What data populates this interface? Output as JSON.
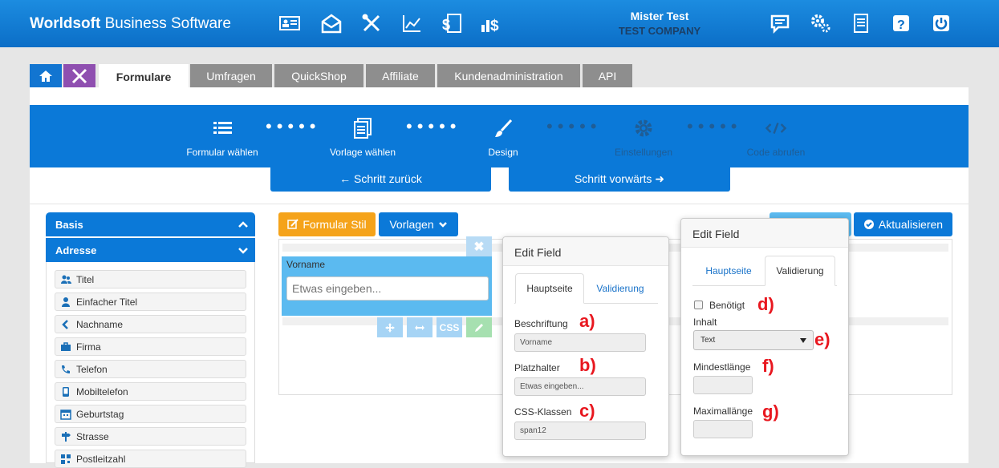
{
  "header": {
    "brand_bold": "Worldsoft",
    "brand_rest": "Business Software",
    "user_name": "Mister Test",
    "company": "TEST COMPANY",
    "icons": [
      "contact-card-icon",
      "mail-icon",
      "tools-icon",
      "chart-icon",
      "invoice-dollar-icon",
      "sales-dollar-icon",
      "chat-icon",
      "settings-gears-icon",
      "document-icon",
      "help-icon",
      "power-icon"
    ]
  },
  "tabs": [
    "Formulare",
    "Umfragen",
    "QuickShop",
    "Affiliate",
    "Kundenadministration",
    "API"
  ],
  "wizard": {
    "steps": [
      {
        "label": "Formular wählen",
        "icon": "list-icon"
      },
      {
        "label": "Vorlage wählen",
        "icon": "template-icon"
      },
      {
        "label": "Design",
        "icon": "brush-icon"
      },
      {
        "label": "Einstellungen",
        "icon": "gear-icon"
      },
      {
        "label": "Code abrufen",
        "icon": "code-icon"
      }
    ],
    "back": "← Schritt zurück",
    "forward": "Schritt vorwärts ➜"
  },
  "sidebar": {
    "basis": "Basis",
    "adresse": "Adresse",
    "items": [
      "Titel",
      "Einfacher Titel",
      "Nachname",
      "Firma",
      "Telefon",
      "Mobiltelefon",
      "Geburtstag",
      "Strasse",
      "Postleitzahl"
    ]
  },
  "toolbar": {
    "formular_stil": "Formular Stil",
    "vorlagen": "Vorlagen",
    "aktualisieren": "Aktualisieren"
  },
  "field": {
    "label": "Vorname",
    "placeholder": "Etwas eingeben...",
    "css_btn": "CSS"
  },
  "popover_left": {
    "title": "Edit Field",
    "tab_main": "Hauptseite",
    "tab_valid": "Validierung",
    "beschriftung_label": "Beschriftung",
    "beschriftung_value": "Vorname",
    "platzhalter_label": "Platzhalter",
    "platzhalter_value": "Etwas eingeben...",
    "css_label": "CSS-Klassen",
    "css_value": "span12"
  },
  "popover_right": {
    "title": "Edit Field",
    "tab_main": "Hauptseite",
    "tab_valid": "Validierung",
    "benoetigt": "Benötigt",
    "inhalt": "Inhalt",
    "inhalt_value": "Text",
    "mindest": "Mindestlänge",
    "maximal": "Maximallänge"
  },
  "annotations": [
    "a)",
    "b)",
    "c)",
    "d)",
    "e)",
    "f)",
    "g)"
  ],
  "colors": {
    "primary": "#0b79d8",
    "orange": "#f5a31a",
    "annotation": "#e8171f",
    "tools_tab": "#8f4fb0"
  }
}
